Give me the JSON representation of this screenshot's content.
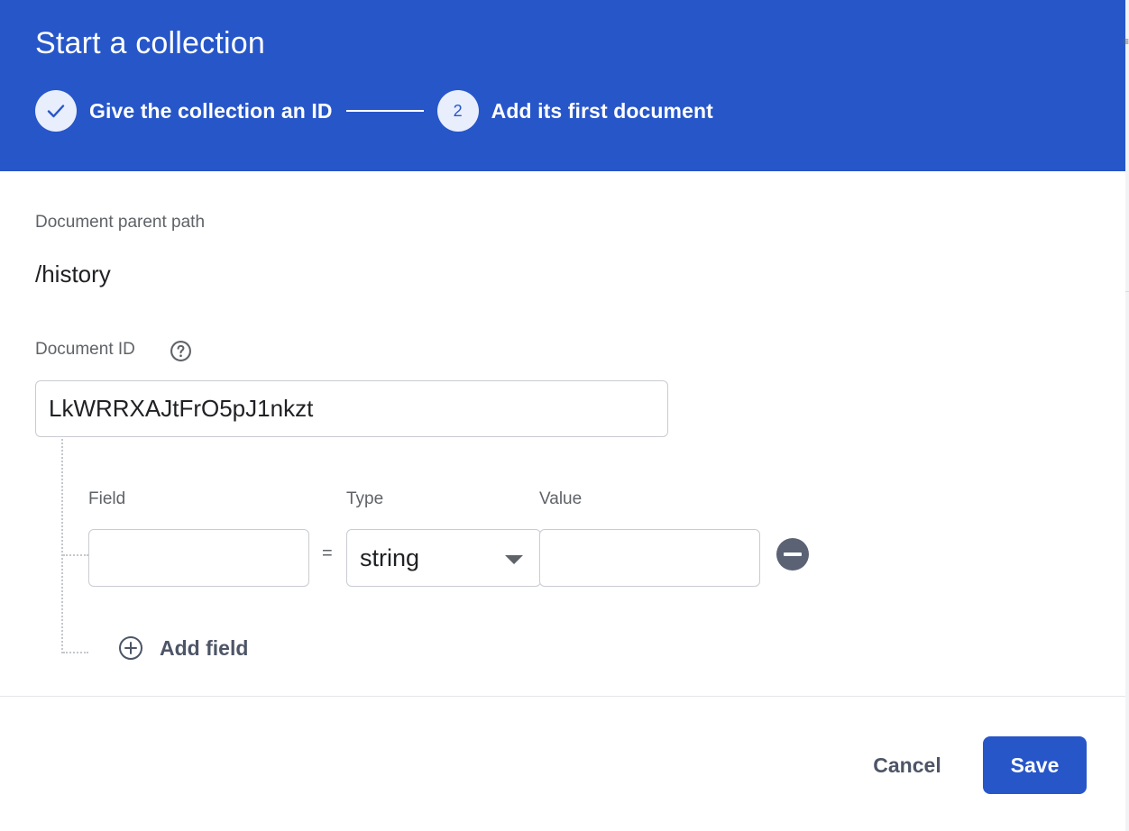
{
  "dialog": {
    "title": "Start a collection"
  },
  "stepper": {
    "steps": [
      {
        "number": "1",
        "label": "Give the collection an ID",
        "state": "completed",
        "icon": "check-icon"
      },
      {
        "number": "2",
        "label": "Add its first document",
        "state": "active"
      }
    ]
  },
  "document": {
    "parent_path_label": "Document parent path",
    "parent_path": "/history",
    "id_label": "Document ID",
    "id_value": "LkWRRXAJtFrO5pJ1nkzt",
    "help_icon": "help-circle-icon"
  },
  "fields": {
    "field_header": "Field",
    "type_header": "Type",
    "value_header": "Value",
    "equals_sign": "=",
    "rows": [
      {
        "field": "",
        "type": "string",
        "value": ""
      }
    ],
    "remove_icon": "remove-circle-icon",
    "add_field_label": "Add field",
    "add_icon": "add-circle-outline-icon"
  },
  "actions": {
    "cancel_label": "Cancel",
    "save_label": "Save"
  },
  "colors": {
    "header_bg": "#2756c9",
    "primary": "#2756c9",
    "text_secondary": "#5f6368",
    "text_primary": "#202124"
  }
}
